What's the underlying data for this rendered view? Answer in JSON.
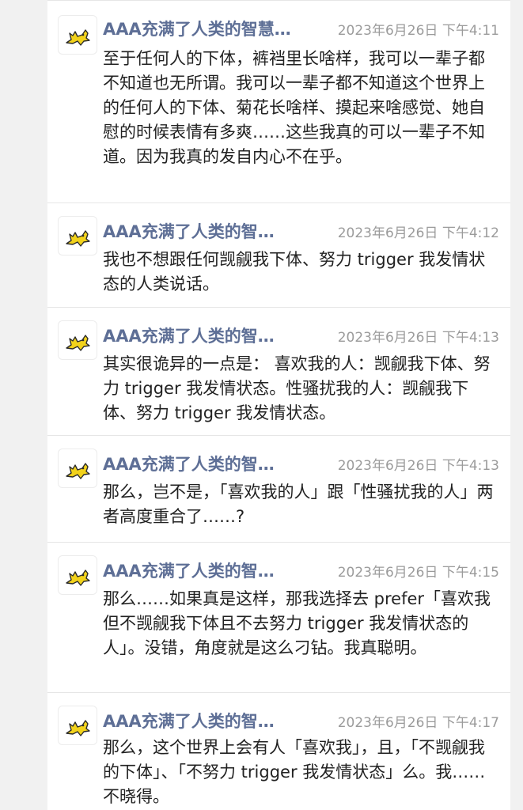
{
  "posts": [
    {
      "author": "AAA充满了人类的智慧…",
      "time": "2023年6月26日 下午4:11",
      "content": "至于任何人的下体，裤裆里长啥样，我可以一辈子都不知道也无所谓。我可以一辈子都不知道这个世界上的任何人的下体、菊花长啥样、摸起来啥感觉、她自慰的时候表情有多爽……这些我真的可以一辈子不知道。因为我真的发自内心不在乎。"
    },
    {
      "author": "AAA充满了人类的智…",
      "time": "2023年6月26日 下午4:12",
      "content": "我也不想跟任何觊觎我下体、努力 trigger 我发情状态的人类说话。"
    },
    {
      "author": "AAA充满了人类的智…",
      "time": "2023年6月26日 下午4:13",
      "content": "其实很诡异的一点是： 喜欢我的人：觊觎我下体、努力 trigger 我发情状态。性骚扰我的人：觊觎我下体、努力 trigger 我发情状态。"
    },
    {
      "author": "AAA充满了人类的智…",
      "time": "2023年6月26日 下午4:13",
      "content": "那么，岂不是，「喜欢我的人」跟「性骚扰我的人」两者高度重合了……?"
    },
    {
      "author": "AAA充满了人类的智…",
      "time": "2023年6月26日 下午4:15",
      "content": "那么……如果真是这样，那我选择去 prefer「喜欢我但不觊觎我下体且不去努力 trigger 我发情状态的人」。没错，角度就是这么刁钻。我真聪明。"
    },
    {
      "author": "AAA充满了人类的智…",
      "time": "2023年6月26日 下午4:17",
      "content": "那么，这个世界上会有人「喜欢我」，且，「不觊觎我的下体」、「不努力 trigger 我发情状态」么。我……不晓得。"
    }
  ]
}
